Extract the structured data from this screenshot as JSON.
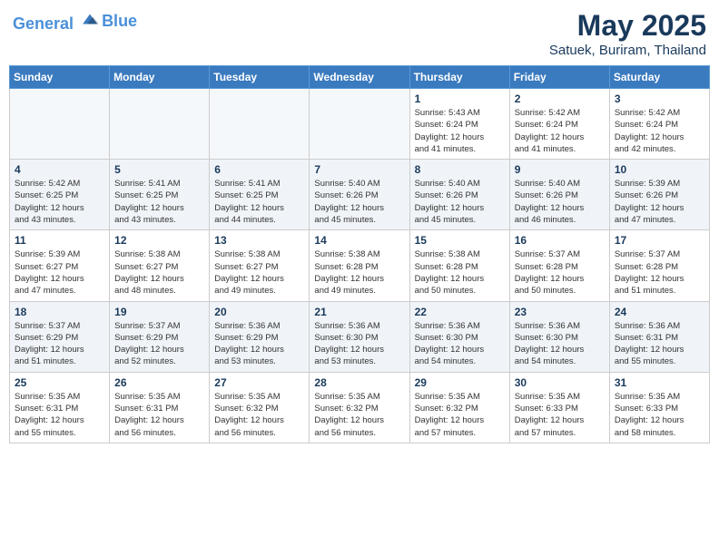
{
  "header": {
    "logo_line1": "General",
    "logo_line2": "Blue",
    "title": "May 2025",
    "subtitle": "Satuek, Buriram, Thailand"
  },
  "weekdays": [
    "Sunday",
    "Monday",
    "Tuesday",
    "Wednesday",
    "Thursday",
    "Friday",
    "Saturday"
  ],
  "weeks": [
    [
      {
        "day": "",
        "info": ""
      },
      {
        "day": "",
        "info": ""
      },
      {
        "day": "",
        "info": ""
      },
      {
        "day": "",
        "info": ""
      },
      {
        "day": "1",
        "info": "Sunrise: 5:43 AM\nSunset: 6:24 PM\nDaylight: 12 hours\nand 41 minutes."
      },
      {
        "day": "2",
        "info": "Sunrise: 5:42 AM\nSunset: 6:24 PM\nDaylight: 12 hours\nand 41 minutes."
      },
      {
        "day": "3",
        "info": "Sunrise: 5:42 AM\nSunset: 6:24 PM\nDaylight: 12 hours\nand 42 minutes."
      }
    ],
    [
      {
        "day": "4",
        "info": "Sunrise: 5:42 AM\nSunset: 6:25 PM\nDaylight: 12 hours\nand 43 minutes."
      },
      {
        "day": "5",
        "info": "Sunrise: 5:41 AM\nSunset: 6:25 PM\nDaylight: 12 hours\nand 43 minutes."
      },
      {
        "day": "6",
        "info": "Sunrise: 5:41 AM\nSunset: 6:25 PM\nDaylight: 12 hours\nand 44 minutes."
      },
      {
        "day": "7",
        "info": "Sunrise: 5:40 AM\nSunset: 6:26 PM\nDaylight: 12 hours\nand 45 minutes."
      },
      {
        "day": "8",
        "info": "Sunrise: 5:40 AM\nSunset: 6:26 PM\nDaylight: 12 hours\nand 45 minutes."
      },
      {
        "day": "9",
        "info": "Sunrise: 5:40 AM\nSunset: 6:26 PM\nDaylight: 12 hours\nand 46 minutes."
      },
      {
        "day": "10",
        "info": "Sunrise: 5:39 AM\nSunset: 6:26 PM\nDaylight: 12 hours\nand 47 minutes."
      }
    ],
    [
      {
        "day": "11",
        "info": "Sunrise: 5:39 AM\nSunset: 6:27 PM\nDaylight: 12 hours\nand 47 minutes."
      },
      {
        "day": "12",
        "info": "Sunrise: 5:38 AM\nSunset: 6:27 PM\nDaylight: 12 hours\nand 48 minutes."
      },
      {
        "day": "13",
        "info": "Sunrise: 5:38 AM\nSunset: 6:27 PM\nDaylight: 12 hours\nand 49 minutes."
      },
      {
        "day": "14",
        "info": "Sunrise: 5:38 AM\nSunset: 6:28 PM\nDaylight: 12 hours\nand 49 minutes."
      },
      {
        "day": "15",
        "info": "Sunrise: 5:38 AM\nSunset: 6:28 PM\nDaylight: 12 hours\nand 50 minutes."
      },
      {
        "day": "16",
        "info": "Sunrise: 5:37 AM\nSunset: 6:28 PM\nDaylight: 12 hours\nand 50 minutes."
      },
      {
        "day": "17",
        "info": "Sunrise: 5:37 AM\nSunset: 6:28 PM\nDaylight: 12 hours\nand 51 minutes."
      }
    ],
    [
      {
        "day": "18",
        "info": "Sunrise: 5:37 AM\nSunset: 6:29 PM\nDaylight: 12 hours\nand 51 minutes."
      },
      {
        "day": "19",
        "info": "Sunrise: 5:37 AM\nSunset: 6:29 PM\nDaylight: 12 hours\nand 52 minutes."
      },
      {
        "day": "20",
        "info": "Sunrise: 5:36 AM\nSunset: 6:29 PM\nDaylight: 12 hours\nand 53 minutes."
      },
      {
        "day": "21",
        "info": "Sunrise: 5:36 AM\nSunset: 6:30 PM\nDaylight: 12 hours\nand 53 minutes."
      },
      {
        "day": "22",
        "info": "Sunrise: 5:36 AM\nSunset: 6:30 PM\nDaylight: 12 hours\nand 54 minutes."
      },
      {
        "day": "23",
        "info": "Sunrise: 5:36 AM\nSunset: 6:30 PM\nDaylight: 12 hours\nand 54 minutes."
      },
      {
        "day": "24",
        "info": "Sunrise: 5:36 AM\nSunset: 6:31 PM\nDaylight: 12 hours\nand 55 minutes."
      }
    ],
    [
      {
        "day": "25",
        "info": "Sunrise: 5:35 AM\nSunset: 6:31 PM\nDaylight: 12 hours\nand 55 minutes."
      },
      {
        "day": "26",
        "info": "Sunrise: 5:35 AM\nSunset: 6:31 PM\nDaylight: 12 hours\nand 56 minutes."
      },
      {
        "day": "27",
        "info": "Sunrise: 5:35 AM\nSunset: 6:32 PM\nDaylight: 12 hours\nand 56 minutes."
      },
      {
        "day": "28",
        "info": "Sunrise: 5:35 AM\nSunset: 6:32 PM\nDaylight: 12 hours\nand 56 minutes."
      },
      {
        "day": "29",
        "info": "Sunrise: 5:35 AM\nSunset: 6:32 PM\nDaylight: 12 hours\nand 57 minutes."
      },
      {
        "day": "30",
        "info": "Sunrise: 5:35 AM\nSunset: 6:33 PM\nDaylight: 12 hours\nand 57 minutes."
      },
      {
        "day": "31",
        "info": "Sunrise: 5:35 AM\nSunset: 6:33 PM\nDaylight: 12 hours\nand 58 minutes."
      }
    ]
  ]
}
